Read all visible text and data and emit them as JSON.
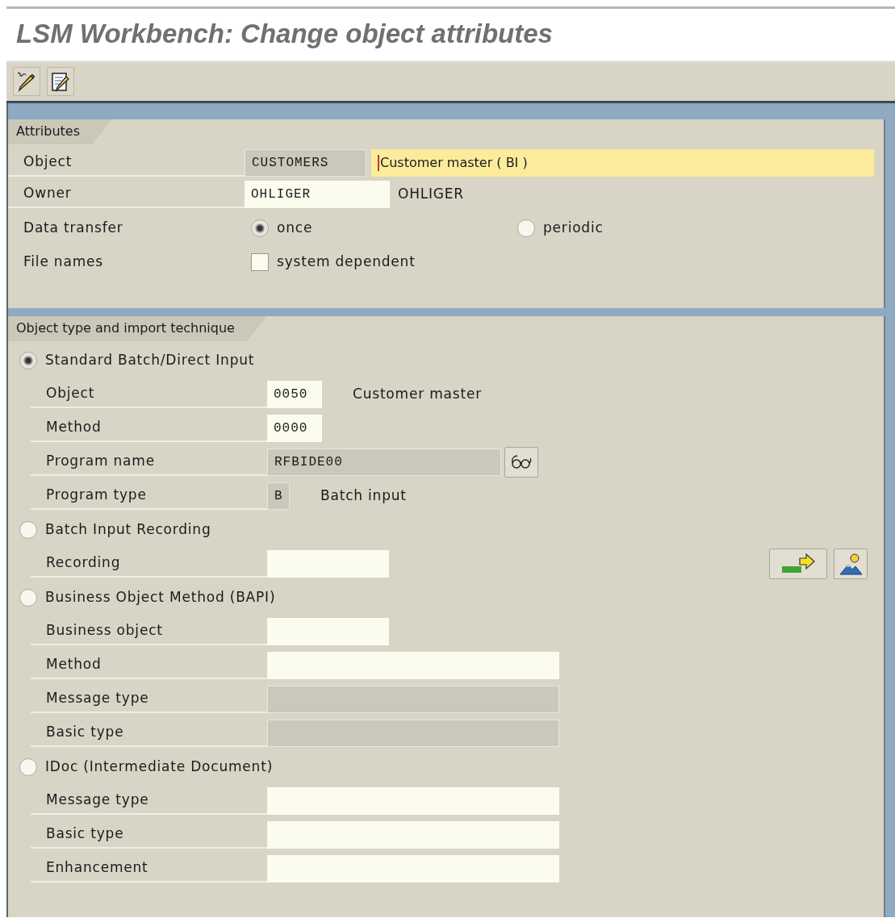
{
  "title": "LSM Workbench: Change object attributes",
  "attributes": {
    "tab": "Attributes",
    "object": {
      "label": "Object",
      "value": "CUSTOMERS",
      "description": "Customer master ( BI )",
      "focused": true
    },
    "owner": {
      "label": "Owner",
      "value": "OHLIGER",
      "name": "OHLIGER"
    },
    "data_transfer": {
      "label": "Data transfer",
      "options": [
        {
          "label": "once",
          "selected": true
        },
        {
          "label": "periodic",
          "selected": false
        }
      ]
    },
    "file_names": {
      "label": "File names",
      "option": {
        "label": "system dependent",
        "checked": false
      }
    }
  },
  "technique": {
    "tab": "Object type and import technique",
    "methods": [
      {
        "label": "Standard Batch/Direct Input",
        "selected": true,
        "fields": [
          {
            "label": "Object",
            "kind": "input",
            "value": "0050",
            "description": "Customer master"
          },
          {
            "label": "Method",
            "kind": "input",
            "value": "0000"
          },
          {
            "label": "Program name",
            "kind": "display",
            "value": "RFBIDE00",
            "search": true
          },
          {
            "label": "Program type",
            "kind": "display",
            "value": "B",
            "description": "Batch input"
          }
        ]
      },
      {
        "label": "Batch Input Recording",
        "selected": false,
        "fields": [
          {
            "label": "Recording",
            "kind": "input",
            "actions": true
          }
        ]
      },
      {
        "label": "Business Object Method (BAPI)",
        "selected": false,
        "fields": [
          {
            "label": "Business object",
            "kind": "input"
          },
          {
            "label": "Method",
            "kind": "input"
          },
          {
            "label": "Message type",
            "kind": "display"
          },
          {
            "label": "Basic type",
            "kind": "display"
          }
        ]
      },
      {
        "label": "IDoc (Intermediate Document)",
        "selected": false,
        "fields": [
          {
            "label": "Message type",
            "kind": "input"
          },
          {
            "label": "Basic type",
            "kind": "input"
          },
          {
            "label": "Enhancement",
            "kind": "input"
          }
        ]
      }
    ]
  }
}
